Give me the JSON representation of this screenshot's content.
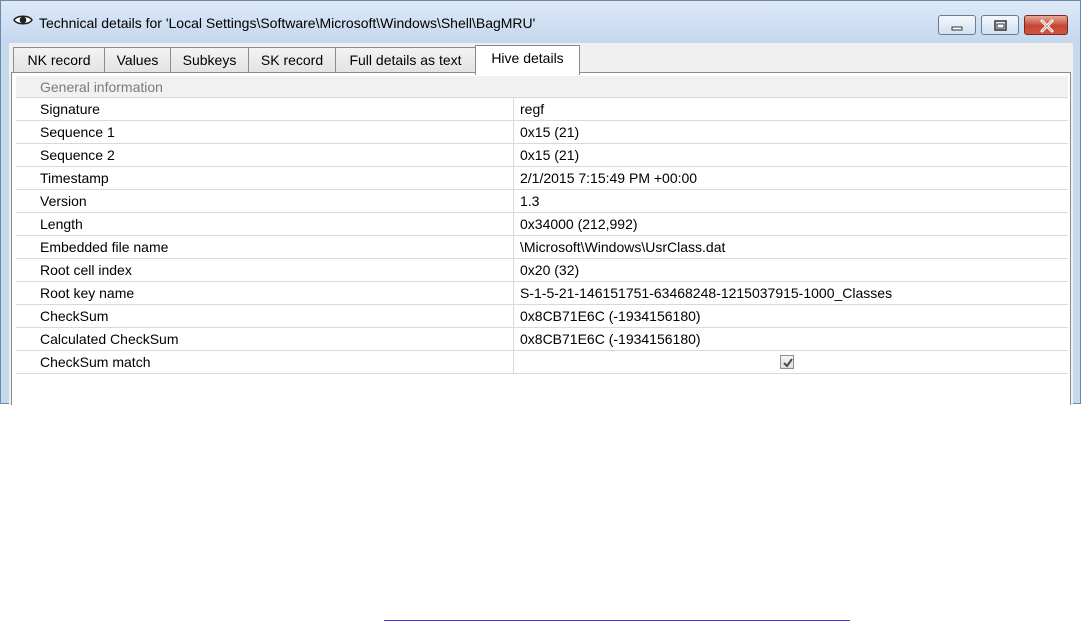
{
  "window": {
    "title": "Technical details for 'Local Settings\\Software\\Microsoft\\Windows\\Shell\\BagMRU'",
    "title_icon": "eye-icon",
    "controls": [
      "minimize-icon",
      "maximize-icon",
      "close-icon"
    ]
  },
  "tabs": [
    {
      "label": "NK record"
    },
    {
      "label": "Values"
    },
    {
      "label": "Subkeys"
    },
    {
      "label": "SK record"
    },
    {
      "label": "Full details as text"
    },
    {
      "label": "Hive details",
      "active": true
    }
  ],
  "details": {
    "group": "General information",
    "rows": [
      {
        "name": "Signature",
        "value": "regf"
      },
      {
        "name": "Sequence 1",
        "value": "0x15 (21)"
      },
      {
        "name": "Sequence 2",
        "value": "0x15 (21)"
      },
      {
        "name": "Timestamp",
        "value": "2/1/2015 7:15:49 PM +00:00"
      },
      {
        "name": "Version",
        "value": "1.3"
      },
      {
        "name": "Length",
        "value": "0x34000 (212,992)"
      },
      {
        "name": "Embedded file name",
        "value": "\\Microsoft\\Windows\\UsrClass.dat"
      },
      {
        "name": "Root cell index",
        "value": "0x20 (32)"
      },
      {
        "name": "Root key name",
        "value": "S-1-5-21-146151751-63468248-1215037915-1000_Classes"
      },
      {
        "name": "CheckSum",
        "value": "0x8CB71E6C (-1934156180)"
      },
      {
        "name": "Calculated CheckSum",
        "value": "0x8CB71E6C (-1934156180)"
      },
      {
        "name": "CheckSum match",
        "checked": true
      }
    ]
  },
  "colors": {
    "frame": "#c6d9ef",
    "grid_line": "#d9d9d9",
    "group_text": "#7b7b7b",
    "close_button": "#c64632",
    "link": "#3b3bd6"
  }
}
